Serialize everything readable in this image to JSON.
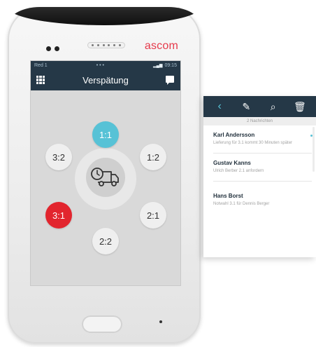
{
  "device": {
    "brand": "ascom"
  },
  "status_bar": {
    "carrier": "Red 1",
    "dots": "• • •",
    "signal": "▂▄▆",
    "time": "09:15"
  },
  "app_bar": {
    "title": "Verspätung",
    "menu_icon": "grid-icon",
    "chat_icon": "chat-icon"
  },
  "priorities": [
    {
      "label": "1:1",
      "color": "#57c2d6"
    },
    {
      "label": "1:2",
      "color": "#efefef"
    },
    {
      "label": "2:1",
      "color": "#efefef"
    },
    {
      "label": "2:2",
      "color": "#efefef"
    },
    {
      "label": "3:1",
      "color": "#e2252e"
    },
    {
      "label": "3:2",
      "color": "#efefef"
    }
  ],
  "center_icon": "delivery-truck-clock-icon",
  "panel": {
    "toolbar": {
      "back": "‹",
      "compose": "✎",
      "search": "⌕",
      "delete": "🗑"
    },
    "subheader": "2 Nachrichten",
    "messages": [
      {
        "name": "Karl Andersson",
        "text": "Lieferung für 3.1 kommt 30 Minuten später",
        "unread": true
      },
      {
        "name": "Gustav Kanns",
        "text": "Ulrich Berber 2.1 anfordern",
        "unread": false
      },
      {
        "name": "Hans Borst",
        "text": "Notwahl 3.1 für Dennis Berger",
        "unread": false
      }
    ]
  },
  "colors": {
    "bar": "#253847",
    "accent": "#57c2d6",
    "alert": "#e2252e",
    "brand": "#e63a4b"
  }
}
